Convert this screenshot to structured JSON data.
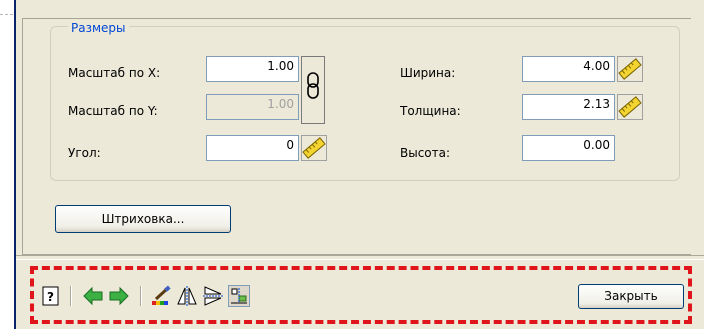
{
  "group": {
    "title": "Размеры"
  },
  "fields": {
    "scale_x": {
      "label": "Масштаб по X:",
      "value": "1.00"
    },
    "scale_y": {
      "label": "Масштаб по Y:",
      "value": "1.00"
    },
    "angle": {
      "label": "Угол:",
      "value": "0"
    },
    "width": {
      "label": "Ширина:",
      "value": "4.00"
    },
    "thickness": {
      "label": "Толщина:",
      "value": "2.13"
    },
    "height": {
      "label": "Высота:",
      "value": "0.00"
    }
  },
  "buttons": {
    "hatch": "Штриховка...",
    "close": "Закрыть"
  },
  "toolbar": {
    "icons": [
      "help-icon",
      "arrow-left-icon",
      "arrow-right-icon",
      "paint-brush-icon",
      "mirror-horizontal-icon",
      "mirror-vertical-icon",
      "snap-icon"
    ]
  },
  "colors": {
    "dialog_bg": "#ece9d8",
    "legend_text": "#0046d5",
    "highlight_dash": "#e0151b",
    "arrow_green": "#3cb043"
  }
}
